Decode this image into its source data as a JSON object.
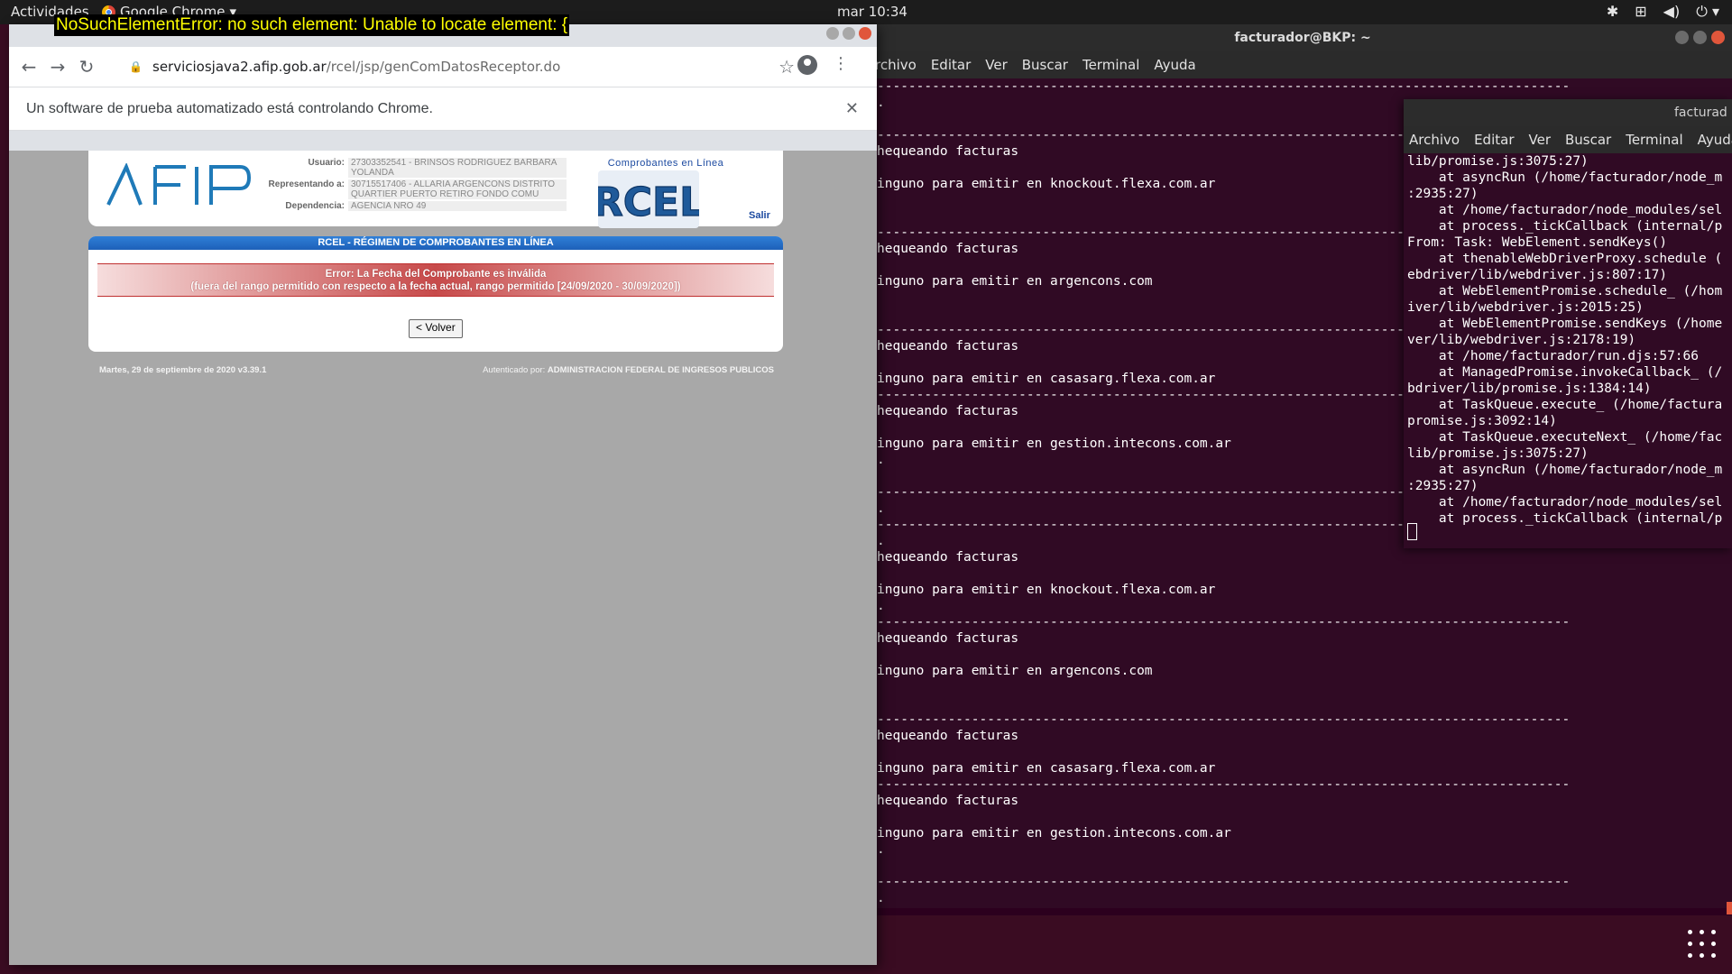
{
  "topbar": {
    "activities": "Actividades",
    "app_name": "Google Chrome",
    "clock": "mar 10:34"
  },
  "error_overlay": "NoSuchElementError: no such element: Unable to locate element: {",
  "chrome": {
    "url_host": "serviciosjava2.afip.gob.ar",
    "url_path": "/rcel/jsp/genComDatosReceptor.do",
    "infobar_text": "Un software de prueba automatizado está controlando Chrome."
  },
  "afip": {
    "usuario_label": "Usuario:",
    "usuario_value": "27303352541 - BRINSOS RODRIGUEZ BARBARA YOLANDA",
    "representando_label": "Representando a:",
    "representando_value": "30715517406 - ALLARIA ARGENCONS DISTRITO QUARTIER PUERTO RETIRO FONDO COMU",
    "dependencia_label": "Dependencia:",
    "dependencia_value": "AGENCIA NRO 49",
    "rcel_subtitle": "Comprobantes en Línea",
    "rcel_logo_text": "RCEL",
    "salir": "Salir",
    "panel_title": "RCEL - RÉGIMEN DE COMPROBANTES EN LÍNEA",
    "error_line1": "Error: La Fecha del Comprobante es inválida",
    "error_line2": "(fuera del rango permitido con respecto a la fecha actual, rango permitido [24/09/2020 - 30/09/2020])",
    "volver": "< Volver",
    "footer_date": "Martes, 29 de septiembre de 2020 v3.39.1",
    "footer_auth_label": "Autenticado por:",
    "footer_auth_value": "ADMINISTRACION FEDERAL DE INGRESOS PUBLICOS"
  },
  "terminal": {
    "title": "facturador@BKP: ~",
    "menu": [
      "rchivo",
      "Editar",
      "Ver",
      "Buscar",
      "Terminal",
      "Ayuda"
    ],
    "lines": [
      "----------------------------------------------------------------------------------------",
      ".",
      "",
      "----------------------------------------------------------------------------------------",
      "hequeando facturas",
      "",
      "inguno para emitir en knockout.flexa.com.ar",
      "",
      "",
      "----------------------------------------------------------------------------------------",
      "hequeando facturas",
      "",
      "inguno para emitir en argencons.com",
      "",
      "",
      "----------------------------------------------------------------------------------------",
      "hequeando facturas",
      "",
      "inguno para emitir en casasarg.flexa.com.ar",
      "----------------------------------------------------------------------------------------",
      "hequeando facturas",
      "",
      "inguno para emitir en gestion.intecons.com.ar",
      ".",
      "",
      "----------------------------------------------------------------------------------------",
      ".",
      "----------------------------------------------------------------------------------------",
      ".",
      "hequeando facturas",
      "",
      "inguno para emitir en knockout.flexa.com.ar",
      ".",
      "----------------------------------------------------------------------------------------",
      "hequeando facturas",
      "",
      "inguno para emitir en argencons.com",
      "",
      "",
      "----------------------------------------------------------------------------------------",
      "hequeando facturas",
      "",
      "inguno para emitir en casasarg.flexa.com.ar",
      "----------------------------------------------------------------------------------------",
      "hequeando facturas",
      "",
      "inguno para emitir en gestion.intecons.com.ar",
      ".",
      "",
      "----------------------------------------------------------------------------------------",
      ".",
      "----------------------------------------------------------------------------------------",
      ".",
      "hequeando facturas",
      "",
      "inguno para emitir en knockout.flexa.com.ar"
    ]
  },
  "terminal2": {
    "title": "facturad",
    "menu": [
      "Archivo",
      "Editar",
      "Ver",
      "Buscar",
      "Terminal",
      "Ayuda"
    ],
    "lines": [
      "lib/promise.js:3075:27)",
      "    at asyncRun (/home/facturador/node_m",
      ":2935:27)",
      "    at /home/facturador/node_modules/sel",
      "    at process._tickCallback (internal/p",
      "From: Task: WebElement.sendKeys()",
      "    at thenableWebDriverProxy.schedule (",
      "ebdriver/lib/webdriver.js:807:17)",
      "    at WebElementPromise.schedule_ (/hom",
      "iver/lib/webdriver.js:2015:25)",
      "    at WebElementPromise.sendKeys (/home",
      "ver/lib/webdriver.js:2178:19)",
      "    at /home/facturador/run.djs:57:66",
      "    at ManagedPromise.invokeCallback_ (/",
      "bdriver/lib/promise.js:1384:14)",
      "    at TaskQueue.execute_ (/home/factura",
      "promise.js:3092:14)",
      "    at TaskQueue.executeNext_ (/home/fac",
      "lib/promise.js:3075:27)",
      "    at asyncRun (/home/facturador/node_m",
      ":2935:27)",
      "    at /home/facturador/node_modules/sel",
      "    at process._tickCallback (internal/p"
    ]
  }
}
